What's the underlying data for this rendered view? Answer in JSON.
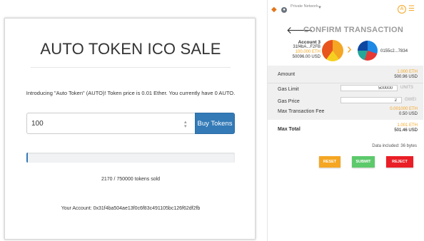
{
  "dapp": {
    "title": "AUTO TOKEN ICO SALE",
    "intro": "Introducing \"Auto Token\" (AUTO)! Token price is 0.01 Ether. You currently have 0 AUTO.",
    "amount_value": "100",
    "buy_label": "Buy Tokens",
    "progress_fraction": 0.003,
    "sold_text": "2170 / 750000 tokens sold",
    "account_text": "Your Account: 0x31f4ba504ae13f0c6f83c491105bc126f62df2fb"
  },
  "metamask": {
    "network_label": "Private Network",
    "account_badge": "A",
    "title": "CONFIRM TRANSACTION",
    "from": {
      "name": "Account 3",
      "address": "31f4bA...F2FB",
      "eth": "100.000 ETH",
      "usd": "50096.00 USD"
    },
    "to_address": "0155c2...7834",
    "amount": {
      "label": "Amount",
      "eth": "1.000 ETH",
      "usd": "500.96 USD"
    },
    "gas_limit": {
      "label": "Gas Limit",
      "value": "500000",
      "unit": "UNITS"
    },
    "gas_price": {
      "label": "Gas Price",
      "value": "2",
      "unit": "GWEI"
    },
    "max_fee": {
      "label": "Max Transaction Fee",
      "eth": "0.001000 ETH",
      "usd": "0.50 USD"
    },
    "max_total": {
      "label": "Max Total",
      "eth": "1.001 ETH",
      "usd": "501.46 USD"
    },
    "data_included": "Data included: 36 bytes",
    "reset_label": "RESET",
    "submit_label": "SUBMIT",
    "reject_label": "REJECT"
  },
  "colors": {
    "primary_blue": "#337ab7",
    "metamask_orange": "#f5a623",
    "submit_green": "#5cc96b",
    "reject_red": "#e91e26"
  }
}
